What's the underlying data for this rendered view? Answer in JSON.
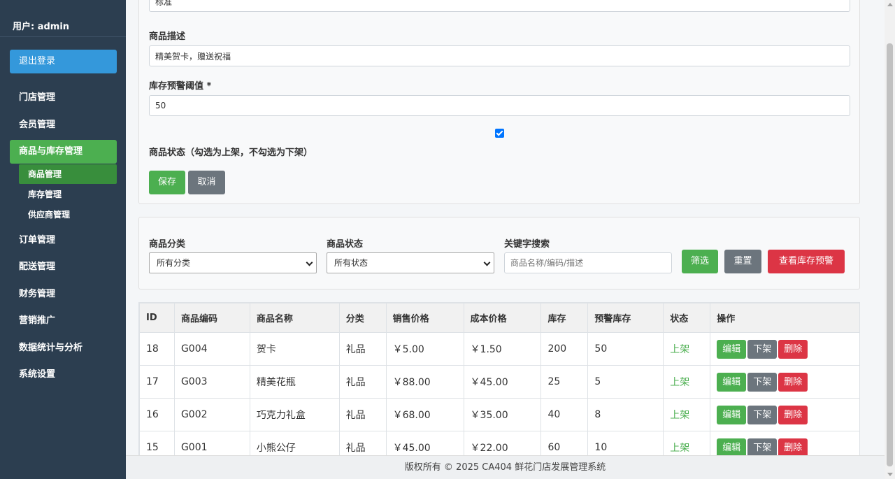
{
  "sidebar": {
    "user": "用户: admin",
    "logout": "退出登录",
    "items": [
      {
        "label": "门店管理"
      },
      {
        "label": "会员管理"
      },
      {
        "label": "商品与库存管理"
      },
      {
        "label": "订单管理"
      },
      {
        "label": "配送管理"
      },
      {
        "label": "财务管理"
      },
      {
        "label": "营销推广"
      },
      {
        "label": "数据统计与分析"
      },
      {
        "label": "系统设置"
      }
    ],
    "subitems": [
      {
        "label": "商品管理"
      },
      {
        "label": "库存管理"
      },
      {
        "label": "供应商管理"
      }
    ]
  },
  "form": {
    "unit_value": "标准",
    "desc_label": "商品描述",
    "desc_value": "精美贺卡，赠送祝福",
    "threshold_label": "库存预警阈值 *",
    "threshold_value": "50",
    "status_label": "商品状态（勾选为上架，不勾选为下架）",
    "status_checked": true,
    "save": "保存",
    "cancel": "取消"
  },
  "filter": {
    "category_label": "商品分类",
    "category_value": "所有分类",
    "status_label": "商品状态",
    "status_value": "所有状态",
    "keyword_label": "关键字搜索",
    "keyword_placeholder": "商品名称/编码/描述",
    "filter_btn": "筛选",
    "reset_btn": "重置",
    "alert_btn": "查看库存预警"
  },
  "table": {
    "headers": [
      "ID",
      "商品编码",
      "商品名称",
      "分类",
      "销售价格",
      "成本价格",
      "库存",
      "预警库存",
      "状态",
      "操作"
    ],
    "rows": [
      {
        "id": "18",
        "code": "G004",
        "name": "贺卡",
        "category": "礼品",
        "price": "￥5.00",
        "cost": "￥1.50",
        "stock": "200",
        "alert": "50",
        "status": "上架"
      },
      {
        "id": "17",
        "code": "G003",
        "name": "精美花瓶",
        "category": "礼品",
        "price": "￥88.00",
        "cost": "￥45.00",
        "stock": "25",
        "alert": "5",
        "status": "上架"
      },
      {
        "id": "16",
        "code": "G002",
        "name": "巧克力礼盒",
        "category": "礼品",
        "price": "￥68.00",
        "cost": "￥35.00",
        "stock": "40",
        "alert": "8",
        "status": "上架"
      },
      {
        "id": "15",
        "code": "G001",
        "name": "小熊公仔",
        "category": "礼品",
        "price": "￥45.00",
        "cost": "￥22.00",
        "stock": "60",
        "alert": "10",
        "status": "上架"
      }
    ],
    "actions": {
      "edit": "编辑",
      "offshelf": "下架",
      "delete": "删除"
    }
  },
  "footer": "版权所有 © 2025 CA404 鲜花门店发展管理系统",
  "colors": {
    "sidebar": "#2c3e50",
    "primary": "#3498db",
    "success": "#4caf50",
    "danger": "#dc3545",
    "secondary": "#6c757d"
  }
}
